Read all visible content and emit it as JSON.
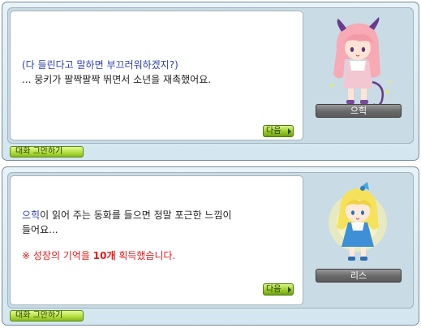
{
  "dialog_top": {
    "line1": "(다 들린다고 말하면 부끄러워하겠지?)",
    "line2": "... 뭉키가 팔짝팔짝 뛰면서 소년을 재촉했어요.",
    "next_label": "다음",
    "speaker_name": "으힉",
    "end_chat_label": "대화 그만하기"
  },
  "dialog_bottom": {
    "line1_name": "으힉",
    "line1_rest": "이 읽어 주는 동화를 들으면 정말 포근한 느낌이",
    "line2": "들어요...",
    "reward_prefix": "※ 성장의 기억을 ",
    "reward_amount": "10개",
    "reward_suffix": " 획득했습니다.",
    "next_label": "다음",
    "speaker_name": "리스",
    "end_chat_label": "대화 그만하기"
  }
}
